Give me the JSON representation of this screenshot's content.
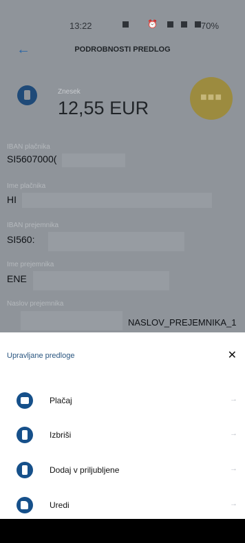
{
  "status_bar": {
    "time": "13:22",
    "battery": "70%"
  },
  "app_bar": {
    "title": "PODROBNOSTI PREDLOG",
    "back_icon": "arrow-left-icon"
  },
  "summary": {
    "amount_label": "Znesek",
    "amount_value": "12,55 EUR",
    "fab_icon": "more-dots-icon"
  },
  "fields": [
    {
      "label": "IBAN plačnika",
      "value": "SI5607000("
    },
    {
      "label": "Ime plačnika",
      "value": "HI"
    },
    {
      "label": "IBAN prejemnika",
      "value": "SI560:"
    },
    {
      "label": "Ime prejemnika",
      "value": "ENE"
    },
    {
      "label": "Naslov prejemnika",
      "value": "NASLOV_PREJEMNIKA_1"
    }
  ],
  "sheet": {
    "title": "Upravljane predloge",
    "close_icon": "close-icon",
    "items": [
      {
        "label": "Plačaj",
        "icon": "wallet-icon"
      },
      {
        "label": "Izbriši",
        "icon": "document-icon"
      },
      {
        "label": "Dodaj v priljubljene",
        "icon": "document-icon"
      },
      {
        "label": "Uredi",
        "icon": "edit-icon"
      }
    ],
    "arrow_icon": "arrow-right-icon"
  },
  "colors": {
    "accent": "#16508a",
    "scrim": "#8f949a",
    "fab": "#9c8b3f"
  }
}
